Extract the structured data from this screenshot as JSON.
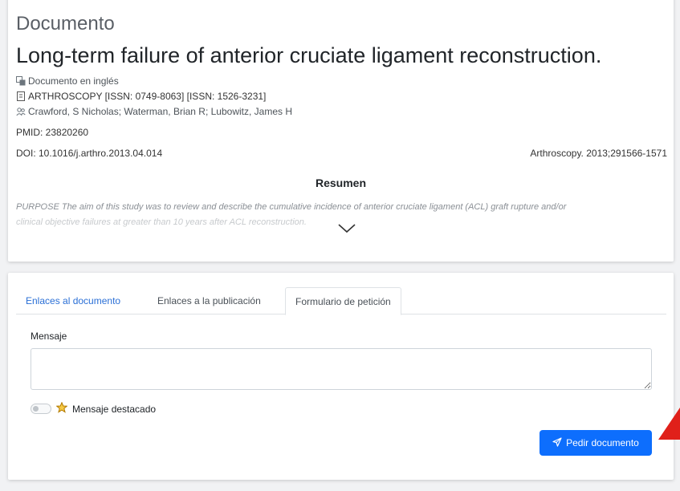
{
  "document": {
    "section_heading": "Documento",
    "title": "Long-term failure of anterior cruciate ligament reconstruction.",
    "language": "Documento en inglés",
    "journal": "ARTHROSCOPY [ISSN: 0749-8063] [ISSN: 1526-3231]",
    "authors": "Crawford, S Nicholas; Waterman, Brian R; Lubowitz, James H",
    "pmid": "PMID: 23820260",
    "doi": "DOI: 10.1016/j.arthro.2013.04.014",
    "citation": "Arthroscopy. 2013;291566-1571",
    "abstract_heading": "Resumen",
    "abstract_line1": "PURPOSE The aim of this study was to review and describe the cumulative incidence of anterior cruciate ligament (ACL) graft rupture and/or",
    "abstract_line2": "clinical objective failures at greater than 10 years after ACL reconstruction."
  },
  "request": {
    "tabs": [
      {
        "label": "Enlaces al documento"
      },
      {
        "label": "Enlaces a la publicación"
      },
      {
        "label": "Formulario de petición"
      }
    ],
    "message_label": "Mensaje",
    "message_value": "",
    "featured_label": "Mensaje destacado",
    "featured_on": false,
    "submit_label": "Pedir documento"
  },
  "colors": {
    "accent": "#0d6efd",
    "link": "#2a6fd6",
    "star": "#f0a800",
    "arrow": "#e0201a"
  },
  "icons": {
    "language": "translate-icon",
    "journal": "journal-icon",
    "authors": "people-icon",
    "abstract_toggle": "chevron-down-icon",
    "featured": "star-icon",
    "submit": "send-icon"
  }
}
